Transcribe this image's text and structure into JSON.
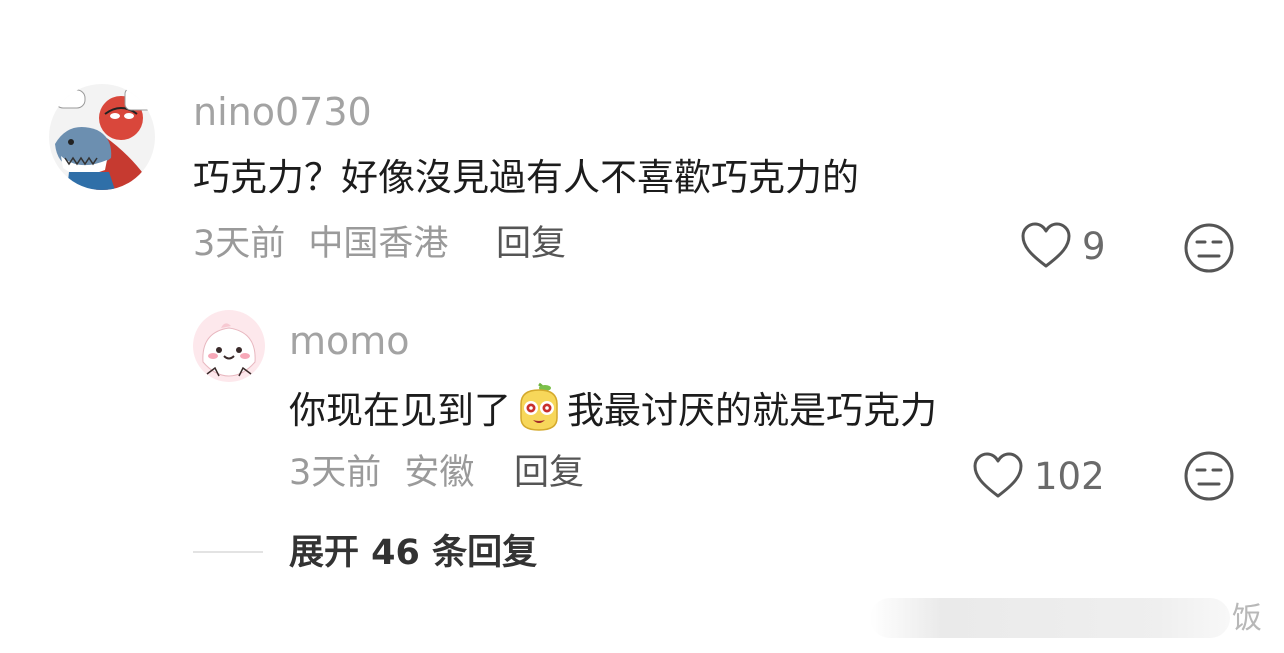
{
  "comments": [
    {
      "username": "nino0730",
      "text": "巧克力？好像沒見過有人不喜歡巧克力的",
      "time": "3天前",
      "location": "中国香港",
      "reply_label": "回复",
      "likes": "9"
    },
    {
      "username": "momo",
      "text_before": "你现在见到了",
      "text_after": "我最讨厌的就是巧克力",
      "time": "3天前",
      "location": "安徽",
      "reply_label": "回复",
      "likes": "102"
    }
  ],
  "expand_label": "展开 46 条回复",
  "watermark": "饭",
  "icons": {
    "like": "heart-outline-icon",
    "dislike": "neutral-face-icon",
    "emoji": "yellow-mascot-emoji-icon"
  },
  "colors": {
    "username": "#a3a3a3",
    "meta": "#9a9a9a",
    "text": "#1c1c1c"
  }
}
